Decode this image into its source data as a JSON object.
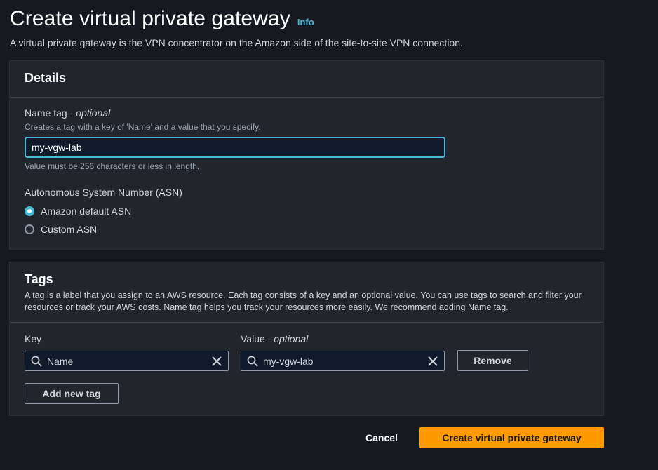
{
  "header": {
    "title": "Create virtual private gateway",
    "info_link": "Info",
    "subtitle": "A virtual private gateway is the VPN concentrator on the Amazon side of the site-to-site VPN connection."
  },
  "details": {
    "title": "Details",
    "name_tag": {
      "label": "Name tag",
      "optional": "optional",
      "description": "Creates a tag with a key of 'Name' and a value that you specify.",
      "value": "my-vgw-lab",
      "constraint": "Value must be 256 characters or less in length."
    },
    "asn": {
      "label": "Autonomous System Number (ASN)",
      "options": [
        {
          "label": "Amazon default ASN",
          "selected": true
        },
        {
          "label": "Custom ASN",
          "selected": false
        }
      ]
    }
  },
  "tags": {
    "title": "Tags",
    "description": "A tag is a label that you assign to an AWS resource. Each tag consists of a key and an optional value. You can use tags to search and filter your resources or track your AWS costs. Name tag helps you track your resources more easily. We recommend adding Name tag.",
    "key_label": "Key",
    "value_label": "Value",
    "value_optional": "optional",
    "rows": [
      {
        "key": "Name",
        "value": "my-vgw-lab"
      }
    ],
    "remove_label": "Remove",
    "add_label": "Add new tag"
  },
  "footer": {
    "cancel_label": "Cancel",
    "submit_label": "Create virtual private gateway"
  },
  "colors": {
    "background": "#16191f",
    "panel": "#22252b",
    "accent": "#44b9d6",
    "primary_button": "#ff9900"
  },
  "icons": [
    "search-icon",
    "close-icon"
  ]
}
